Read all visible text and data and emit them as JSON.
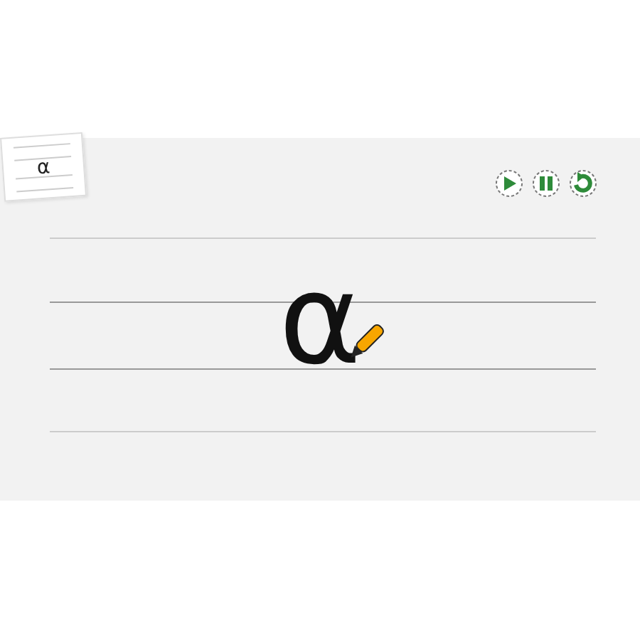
{
  "thumbnail": {
    "letter": "α"
  },
  "controls": [
    {
      "kind": "play"
    },
    {
      "kind": "pause"
    },
    {
      "kind": "replay"
    }
  ],
  "letter": "α"
}
